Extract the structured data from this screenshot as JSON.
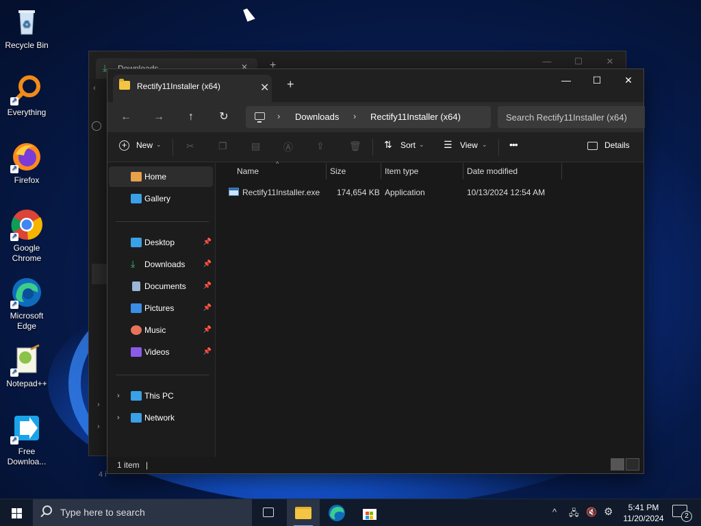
{
  "desktop": {
    "icons": [
      {
        "label": "Recycle Bin",
        "icon": "recycle-bin-icon"
      },
      {
        "label": "Everything",
        "icon": "everything-icon"
      },
      {
        "label": "Firefox",
        "icon": "firefox-icon"
      },
      {
        "label": "Google Chrome",
        "icon": "chrome-icon"
      },
      {
        "label": "Microsoft Edge",
        "icon": "edge-icon"
      },
      {
        "label": "Notepad++",
        "icon": "notepadpp-icon"
      },
      {
        "label": "Free Downloa...",
        "icon": "free-download-manager-icon"
      }
    ]
  },
  "background_window": {
    "tab_label": "Downloads",
    "status": "4 i"
  },
  "window": {
    "tab_label": "Rectify11Installer (x64)",
    "tab_close": "✕",
    "tab_new": "+",
    "controls": {
      "minimize": "—",
      "maximize": "☐",
      "close": "✕"
    },
    "address": {
      "crumbs": [
        "Downloads",
        "Rectify11Installer (x64)"
      ],
      "separator": "›"
    },
    "search_placeholder": "Search Rectify11Installer (x64)",
    "toolbar": {
      "new_label": "New",
      "sort_label": "Sort",
      "view_label": "View",
      "more_label": "•••",
      "details_label": "Details"
    },
    "sidebar": {
      "top": [
        {
          "label": "Home",
          "icon": "home-icon",
          "color": "#e8a04a",
          "selected": true
        },
        {
          "label": "Gallery",
          "icon": "gallery-icon",
          "color": "#3aa0e8"
        }
      ],
      "pinned": [
        {
          "label": "Desktop",
          "icon": "desktop-icon",
          "color": "#3aa0e8"
        },
        {
          "label": "Downloads",
          "icon": "downloads-icon",
          "color": "#3fbf7a"
        },
        {
          "label": "Documents",
          "icon": "documents-icon",
          "color": "#9bb6d6"
        },
        {
          "label": "Pictures",
          "icon": "pictures-icon",
          "color": "#3a8ee8"
        },
        {
          "label": "Music",
          "icon": "music-icon",
          "color": "#e8735a"
        },
        {
          "label": "Videos",
          "icon": "videos-icon",
          "color": "#8a5ae8"
        }
      ],
      "bottom": [
        {
          "label": "This PC",
          "icon": "this-pc-icon",
          "color": "#3aa0e8"
        },
        {
          "label": "Network",
          "icon": "network-icon",
          "color": "#3aa0e8"
        }
      ]
    },
    "columns": [
      "Name",
      "Size",
      "Item type",
      "Date modified"
    ],
    "files": [
      {
        "name": "Rectify11Installer.exe",
        "size": "174,654 KB",
        "type": "Application",
        "modified": "10/13/2024 12:54 AM"
      }
    ],
    "status": "1 item"
  },
  "taskbar": {
    "search_placeholder": "Type here to search",
    "time": "5:41 PM",
    "date": "11/20/2024",
    "notification_count": "2"
  }
}
